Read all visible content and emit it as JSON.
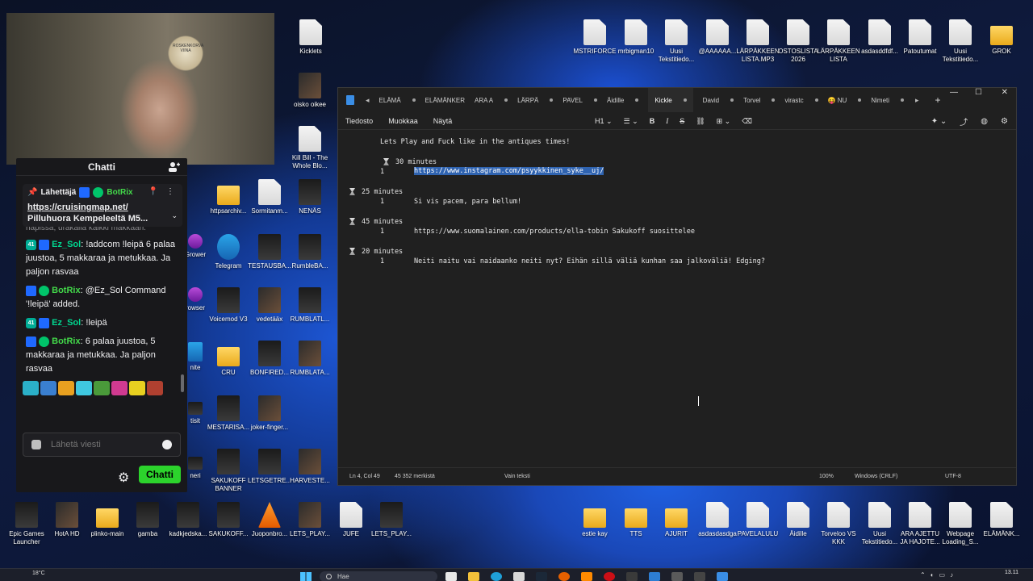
{
  "desktop": {
    "top_icons": [
      {
        "label": "Kicklets",
        "kind": "file"
      },
      {
        "label": "MSTRIFORCE",
        "kind": "file"
      },
      {
        "label": "mrbigman10",
        "kind": "file"
      },
      {
        "label": "Uusi Tekstitiedo...",
        "kind": "file"
      },
      {
        "label": "@AAAAAA...",
        "kind": "file"
      },
      {
        "label": "LÄRPÄKKEEN LISTA.MP3",
        "kind": "file"
      },
      {
        "label": "OSTOSLISTA 2026",
        "kind": "file"
      },
      {
        "label": "LÄRPÄKKEEN LISTA",
        "kind": "file"
      },
      {
        "label": "asdasddfdf...",
        "kind": "file"
      },
      {
        "label": "Patoutumat",
        "kind": "file"
      },
      {
        "label": "Uusi Tekstitiedo...",
        "kind": "file"
      },
      {
        "label": "GROK",
        "kind": "folder"
      }
    ],
    "mid_icons": [
      {
        "label": "oisko oikee",
        "kind": "media"
      },
      {
        "label": "Kill Bill - The Whole Blo...",
        "kind": "file"
      },
      {
        "label": "httpsarchiv...",
        "kind": "folder"
      },
      {
        "label": "Sormitanm...",
        "kind": "file"
      },
      {
        "label": "NENÄS",
        "kind": "dark"
      },
      {
        "label": "Telegram",
        "kind": "blue"
      },
      {
        "label": "TESTAUSBA...",
        "kind": "dark"
      },
      {
        "label": "RumbleBA...",
        "kind": "dark"
      },
      {
        "label": "Voicemod V3",
        "kind": "dark"
      },
      {
        "label": "vedetääx",
        "kind": "media"
      },
      {
        "label": "RUMBLATL...",
        "kind": "dark"
      },
      {
        "label": "CRU",
        "kind": "folder"
      },
      {
        "label": "BONFIRED...",
        "kind": "dark"
      },
      {
        "label": "RUMBLATA...",
        "kind": "media"
      },
      {
        "label": "MESTARISA...",
        "kind": "dark"
      },
      {
        "label": "joker-finger...",
        "kind": "media"
      },
      {
        "label": "SAKUKOFF BANNER",
        "kind": "dark"
      },
      {
        "label": "LETSGETRE...",
        "kind": "dark"
      },
      {
        "label": "HARVESTE...",
        "kind": "media"
      }
    ],
    "bottom_icons": [
      {
        "label": "Epic Games Launcher",
        "kind": "dark"
      },
      {
        "label": "HotA HD",
        "kind": "media"
      },
      {
        "label": "plinko-main",
        "kind": "folder"
      },
      {
        "label": "gamba",
        "kind": "dark"
      },
      {
        "label": "kadkjedska...",
        "kind": "dark"
      },
      {
        "label": "SAKUKOFF...",
        "kind": "dark"
      },
      {
        "label": "Juoponbro...",
        "kind": "orange"
      },
      {
        "label": "LETS_PLAY...",
        "kind": "media"
      },
      {
        "label": "JUFE",
        "kind": "file"
      },
      {
        "label": "LETS_PLAY...",
        "kind": "dark"
      },
      {
        "label": "estie kay",
        "kind": "folder"
      },
      {
        "label": "TTS",
        "kind": "folder"
      },
      {
        "label": "AJURIT",
        "kind": "folder"
      },
      {
        "label": "asdasdasdga",
        "kind": "file"
      },
      {
        "label": "PAVELALULU",
        "kind": "file"
      },
      {
        "label": "Äidille",
        "kind": "file"
      },
      {
        "label": "Torveloo VS KKK",
        "kind": "file"
      },
      {
        "label": "Uusi Tekstitiedo...",
        "kind": "file"
      },
      {
        "label": "ARA AJETTU JA HAJOTE...",
        "kind": "file"
      },
      {
        "label": "Webpage Loading_S...",
        "kind": "file"
      },
      {
        "label": "ELÄMÄNK...",
        "kind": "file"
      }
    ],
    "partial_left": [
      "Grower",
      "rowser",
      "rowser",
      "nite",
      "tisit",
      "neri"
    ],
    "webcam_sign": "ROSKENKORVA VIINA"
  },
  "chat": {
    "title": "Chatti",
    "pinned": {
      "by_label": "Lähettäjä",
      "by_user": "BotRix",
      "link": "https://cruisingmap.net/",
      "text": "Pilluhuora Kempeleeltä M5...",
      "cut_text": "hapissa, urakalla kaikki makkaan."
    },
    "messages": [
      {
        "user": "Ez_Sol",
        "sub": "41",
        "text": "!addcom !leipä 6 palaa juustoa, 5 makkaraa ja metukkaa. Ja paljon rasvaa"
      },
      {
        "user": "BotRix",
        "text": "@Ez_Sol Command '!leipä' added."
      },
      {
        "user": "Ez_Sol",
        "sub": "41",
        "text": "!leipä"
      },
      {
        "user": "BotRix",
        "text": "6 palaa juustoa, 5 makkaraa ja metukkaa. Ja paljon rasvaa"
      }
    ],
    "input_placeholder": "Lähetä viesti",
    "send_label": "Chatti"
  },
  "notepad": {
    "tabs": [
      "ELÄMÄ",
      "ELÄMÄNKER",
      "ARA A",
      "LÄRPÄ",
      "PAVEL",
      "Äidille",
      "Kickle",
      "David",
      "Torvel",
      "virastc",
      "😝 NU",
      "Nimeti"
    ],
    "active_tab": "Kickle",
    "menu": [
      "Tiedosto",
      "Muokkaa",
      "Näytä"
    ],
    "heading_select": "H1",
    "lines": {
      "l1": "Lets Play and Fuck like in the antiques times!",
      "t1": "30 minutes",
      "n1": "1",
      "url1": "https://www.instagram.com/psyykkinen_syke__uj/",
      "t2": "25 minutes",
      "n2": "1",
      "text2": "Si vis pacem, para bellum!",
      "t3": "45 minutes",
      "n3": "1",
      "url3": "https://www.suomalainen.com/products/ella-tobin Sakukoff suosittelee",
      "t4": "20 minutes",
      "n4": "1",
      "text4": "Neiti naitu vai naidaanko neiti nyt? Eihän sillä väliä kunhan saa jalkoväliä! Edging?"
    },
    "status": {
      "position": "Ln 4, Col 49",
      "chars": "45 352 merkistä",
      "format": "Vain teksti",
      "zoom": "100%",
      "line_ending": "Windows (CRLF)",
      "encoding": "UTF-8"
    }
  },
  "taskbar": {
    "weather": "18°C",
    "search_placeholder": "Hae",
    "time": "13.11"
  }
}
